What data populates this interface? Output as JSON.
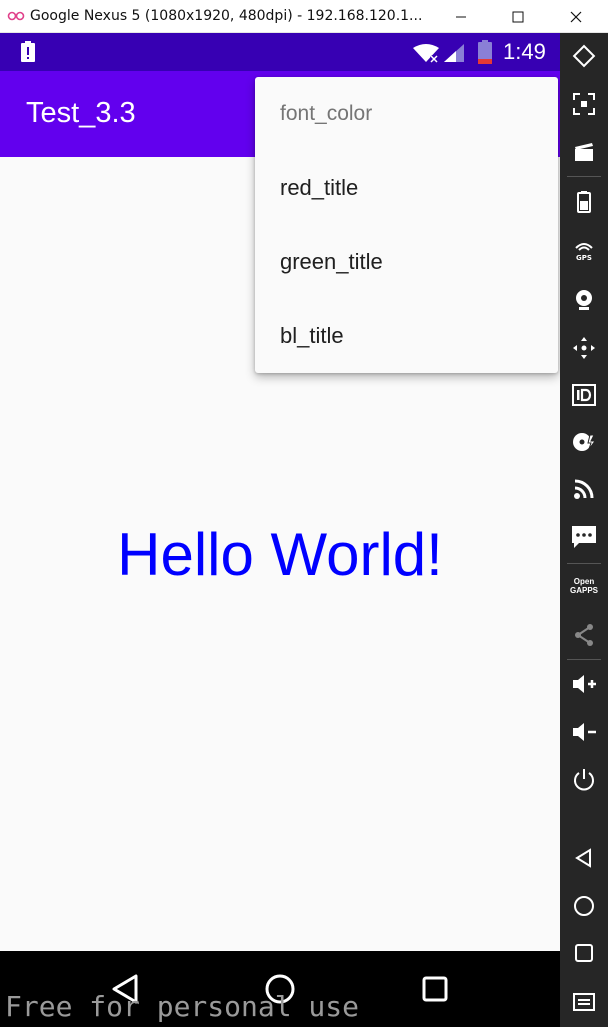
{
  "window": {
    "title": "Google Nexus 5 (1080x1920, 480dpi) - 192.168.120.1...",
    "logo_icon": "infinity-logo-icon",
    "buttons": [
      "minimize-icon",
      "maximize-icon",
      "close-icon"
    ]
  },
  "status_bar": {
    "time": "1:49",
    "icons": [
      "alert-icon",
      "wifi-icon",
      "signal-icon",
      "battery-icon"
    ],
    "color": "#3700b3"
  },
  "app_bar": {
    "title": "Test_3.3",
    "color": "#6200ee"
  },
  "content": {
    "text": "Hello World!",
    "text_color": "#0000ff"
  },
  "menu": {
    "header": "font_color",
    "items": [
      "red_title",
      "green_title",
      "bl_title"
    ]
  },
  "navigation": {
    "buttons": [
      "back-icon",
      "home-icon",
      "recent-apps-icon"
    ]
  },
  "side_toolbar": {
    "buttons": [
      "rotate-icon",
      "fullscreen-icon",
      "screencast-icon",
      "battery-icon",
      "gps-icon",
      "camera-icon",
      "dpad-icon",
      "device-id-icon",
      "disk-icon",
      "cast-icon",
      "sms-icon",
      "open-gapps-icon",
      "share-icon",
      "volume-up-icon",
      "volume-down-icon",
      "power-icon",
      "back-icon",
      "home-icon",
      "overview-icon",
      "menu-icon"
    ],
    "gapps_line1": "Open",
    "gapps_line2": "GAPPS"
  },
  "watermark": "Free for personal use"
}
